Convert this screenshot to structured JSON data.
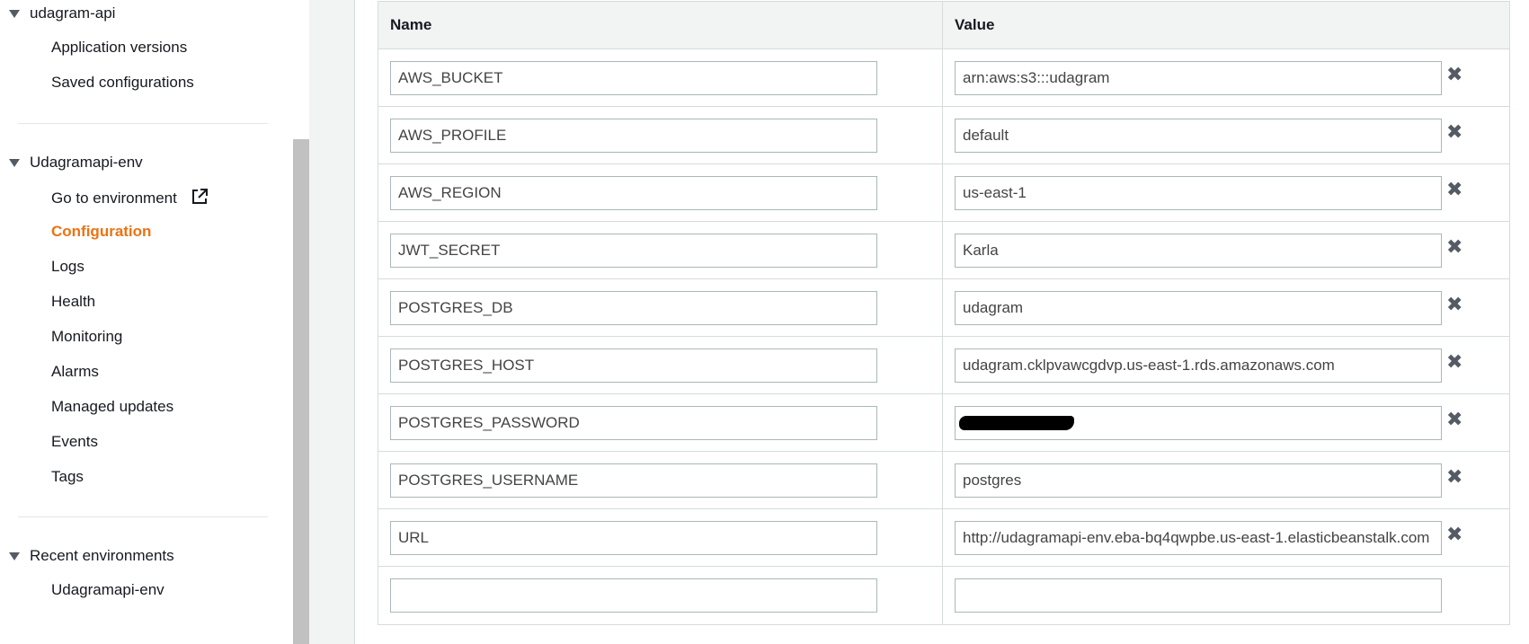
{
  "sidebar": {
    "app": {
      "title": "udagram-api",
      "items": [
        {
          "label": "Application versions"
        },
        {
          "label": "Saved configurations"
        }
      ]
    },
    "env": {
      "title": "Udagramapi-env",
      "items": [
        {
          "label": "Go to environment",
          "external": true
        },
        {
          "label": "Configuration",
          "active": true
        },
        {
          "label": "Logs"
        },
        {
          "label": "Health"
        },
        {
          "label": "Monitoring"
        },
        {
          "label": "Alarms"
        },
        {
          "label": "Managed updates"
        },
        {
          "label": "Events"
        },
        {
          "label": "Tags"
        }
      ]
    },
    "recent": {
      "title": "Recent environments",
      "items": [
        {
          "label": "Udagramapi-env"
        }
      ]
    }
  },
  "table": {
    "headers": {
      "name": "Name",
      "value": "Value"
    },
    "rows": [
      {
        "name": "AWS_BUCKET",
        "value": "arn:aws:s3:::udagram"
      },
      {
        "name": "AWS_PROFILE",
        "value": "default"
      },
      {
        "name": "AWS_REGION",
        "value": "us-east-1"
      },
      {
        "name": "JWT_SECRET",
        "value": "Karla"
      },
      {
        "name": "POSTGRES_DB",
        "value": "udagram"
      },
      {
        "name": "POSTGRES_HOST",
        "value": "udagram.cklpvawcgdvp.us-east-1.rds.amazonaws.com"
      },
      {
        "name": "POSTGRES_PASSWORD",
        "value": "",
        "redacted": true
      },
      {
        "name": "POSTGRES_USERNAME",
        "value": "postgres"
      },
      {
        "name": "URL",
        "value": "http://udagramapi-env.eba-bq4qwpbe.us-east-1.elasticbeanstalk.com"
      },
      {
        "name": "",
        "value": ""
      }
    ],
    "remove_icon": "close-icon"
  },
  "colors": {
    "active": "#ec7211",
    "header_bg": "#f2f3f3",
    "border": "#d5dbdb"
  }
}
